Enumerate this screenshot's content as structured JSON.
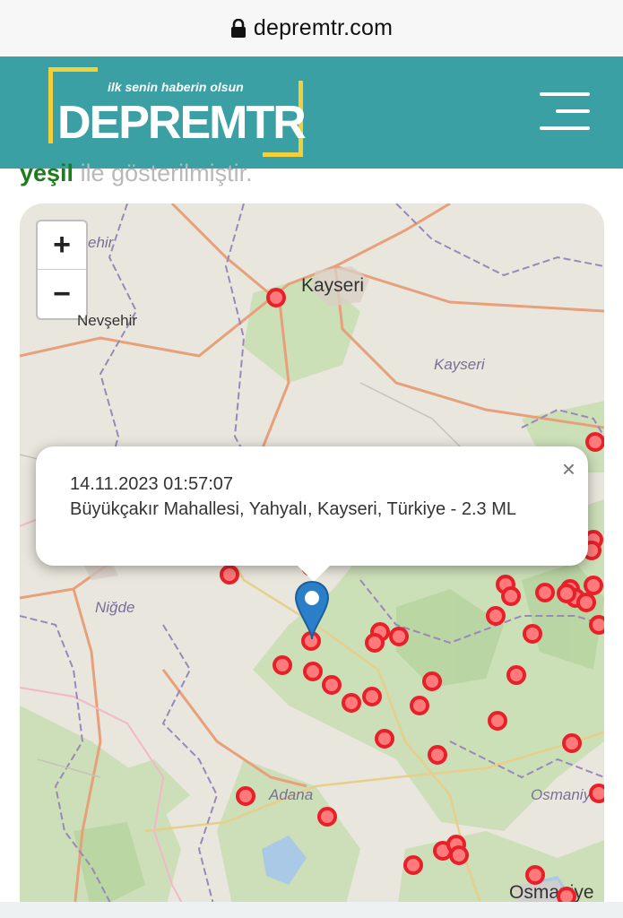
{
  "browser": {
    "url": "depremtr.com",
    "lock_icon": "lock-icon"
  },
  "header": {
    "slogan": "ilk senin haberin olsun",
    "brand": "DEPREMTR",
    "menu_icon": "hamburger-menu-icon",
    "bg_color": "#3aa0a4",
    "accent_color": "#f2d03c"
  },
  "intro": {
    "highlight": "yeşil",
    "rest": " ile gösterilmiştir."
  },
  "map": {
    "zoom_in": "+",
    "zoom_out": "−",
    "labels": {
      "kayseri_city": "Kayseri",
      "kayseri_prov": "Kayseri",
      "nevsehir_city": "Nevşehir",
      "nevsehir_prov_partial": "ehir",
      "nigde_city": "Niğde",
      "nigde_prov": "Niğde",
      "adana": "Adana",
      "osmaniye_prov": "Osmaniy",
      "osmaniye_city": "Osmaniye"
    },
    "marker_color": "#e8202a",
    "pin_color": "#2a7fc8",
    "popup": {
      "date": "14.11.2023 01:57:07",
      "description": "Büyükçakır Mahallesi, Yahyalı, Kayseri, Türkiye - 2.3 ML",
      "close": "×"
    }
  }
}
